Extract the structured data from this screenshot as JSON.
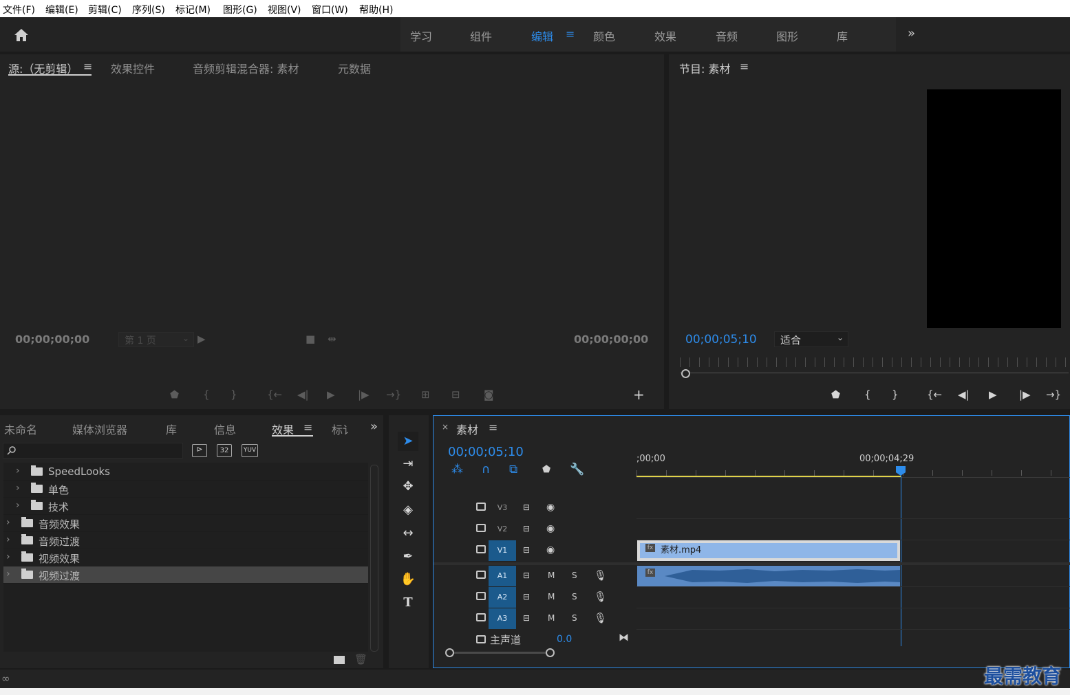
{
  "menu": [
    "文件(F)",
    "编辑(E)",
    "剪辑(C)",
    "序列(S)",
    "标记(M)",
    "图形(G)",
    "视图(V)",
    "窗口(W)",
    "帮助(H)"
  ],
  "workspaces": [
    "学习",
    "组件",
    "编辑",
    "颜色",
    "效果",
    "音频",
    "图形",
    "库"
  ],
  "workspace_active": "编辑",
  "source_panel": {
    "tabs": [
      "源:（无剪辑）",
      "效果控件",
      "音频剪辑混合器: 素材",
      "元数据"
    ],
    "tc_left": "00;00;00;00",
    "tc_right": "00;00;00;00",
    "page_select": "第 1 页"
  },
  "program_panel": {
    "title": "节目: 素材",
    "timecode": "00;00;05;10",
    "zoom": "适合"
  },
  "project_panel": {
    "tabs": [
      "未命名",
      "媒体浏览器",
      "库",
      "信息",
      "效果",
      "标讠"
    ],
    "tree": [
      {
        "label": "SpeedLooks",
        "level": 1,
        "type": "bin-star"
      },
      {
        "label": "单色",
        "level": 1,
        "type": "bin-star"
      },
      {
        "label": "技术",
        "level": 1,
        "type": "bin-star"
      },
      {
        "label": "音频效果",
        "level": 0,
        "type": "folder"
      },
      {
        "label": "音频过渡",
        "level": 0,
        "type": "folder"
      },
      {
        "label": "视频效果",
        "level": 0,
        "type": "folder"
      },
      {
        "label": "视频过渡",
        "level": 0,
        "type": "folder",
        "selected": true
      }
    ],
    "badges": [
      "32",
      "YUV"
    ]
  },
  "timeline": {
    "title": "素材",
    "timecode": "00;00;05;10",
    "ruler_start": ";00;00",
    "ruler_mark": "00;00;04;29",
    "tracks_video": [
      "V3",
      "V2",
      "V1"
    ],
    "tracks_audio": [
      "A1",
      "A2",
      "A3"
    ],
    "master_label": "主声道",
    "master_value": "0.0",
    "clip_name": "素材.mp4",
    "mute": "M",
    "solo": "S"
  },
  "watermark": "最需教育",
  "colors": {
    "accent": "#2d8ceb",
    "clip_video": "#8fb6e8",
    "clip_audio": "#5a89c4"
  }
}
